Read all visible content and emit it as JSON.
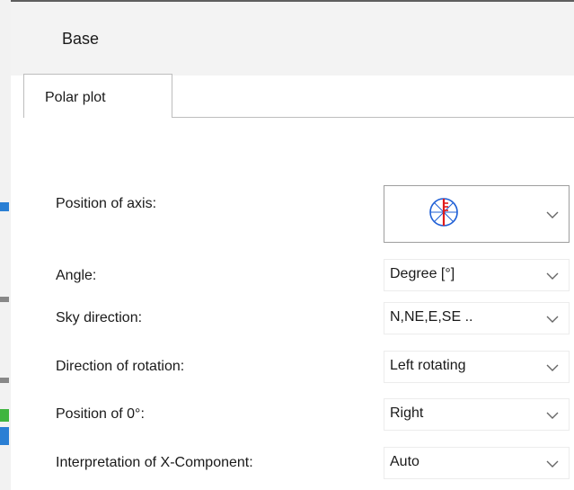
{
  "dialog": {
    "title": "Base"
  },
  "tabs": [
    {
      "label": "Polar plot"
    }
  ],
  "form": {
    "position_of_axis": {
      "label": "Position of axis:",
      "icon": "polar-axis-icon"
    },
    "angle": {
      "label": "Angle:",
      "value": "Degree [°]"
    },
    "sky_direction": {
      "label": "Sky direction:",
      "value": "N,NE,E,SE .."
    },
    "direction_of_rotation": {
      "label": "Direction of rotation:",
      "value": "Left rotating"
    },
    "position_of_zero": {
      "label": "Position of 0°:",
      "value": "Right"
    },
    "x_component": {
      "label": "Interpretation of X-Component:",
      "value": "Auto"
    }
  },
  "colors": {
    "header_bg": "#f3f3f3",
    "icon_blue": "#1e5fd6",
    "icon_red": "#e01b1b"
  }
}
